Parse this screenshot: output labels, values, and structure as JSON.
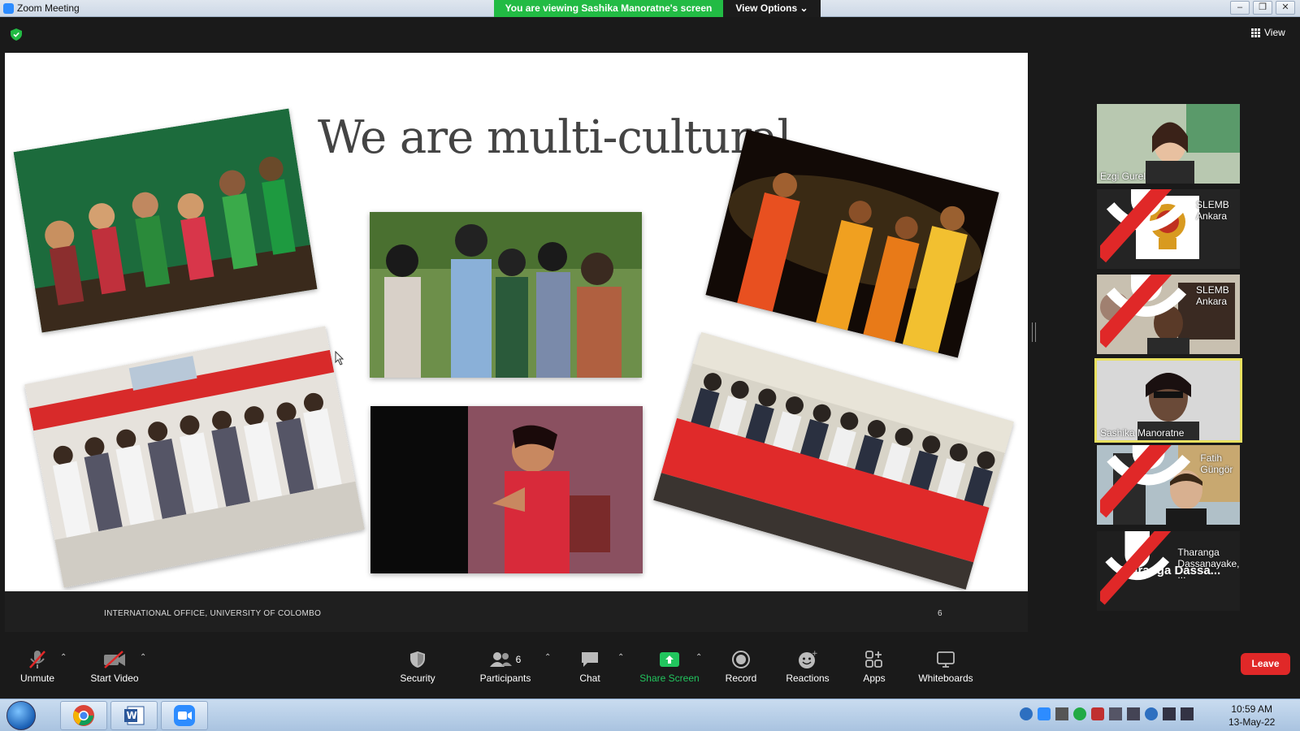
{
  "window": {
    "title": "Zoom Meeting",
    "share_banner": "You are viewing Sashika Manoratne's screen",
    "view_options": "View Options",
    "view_button": "View"
  },
  "slide": {
    "title": "We are multi-cultural",
    "footer": "INTERNATIONAL OFFICE, UNIVERSITY OF COLOMBO",
    "page_number": "6"
  },
  "participants": [
    {
      "name": "Ezgi Gurel",
      "muted": false
    },
    {
      "name": "SLEMB Ankara",
      "muted": true
    },
    {
      "name": "SLEMB Ankara",
      "muted": true
    },
    {
      "name": "Sashika Manoratne",
      "muted": false,
      "active_speaker": true
    },
    {
      "name": "Fatih Güngör",
      "muted": true
    },
    {
      "name": "Tharanga Dassanayake, ...",
      "display": "Tharanga Dassa...",
      "muted": true
    }
  ],
  "toolbar": {
    "unmute": "Unmute",
    "start_video": "Start Video",
    "security": "Security",
    "participants": "Participants",
    "participants_count": "6",
    "chat": "Chat",
    "share_screen": "Share Screen",
    "record": "Record",
    "reactions": "Reactions",
    "apps": "Apps",
    "whiteboards": "Whiteboards",
    "leave": "Leave"
  },
  "taskbar": {
    "time": "10:59 AM",
    "date": "13-May-22"
  },
  "colors": {
    "share_banner": "#22bb44",
    "share_screen_icon": "#22c55e",
    "leave": "#e02828",
    "active_speaker_border": "#e8e060"
  }
}
